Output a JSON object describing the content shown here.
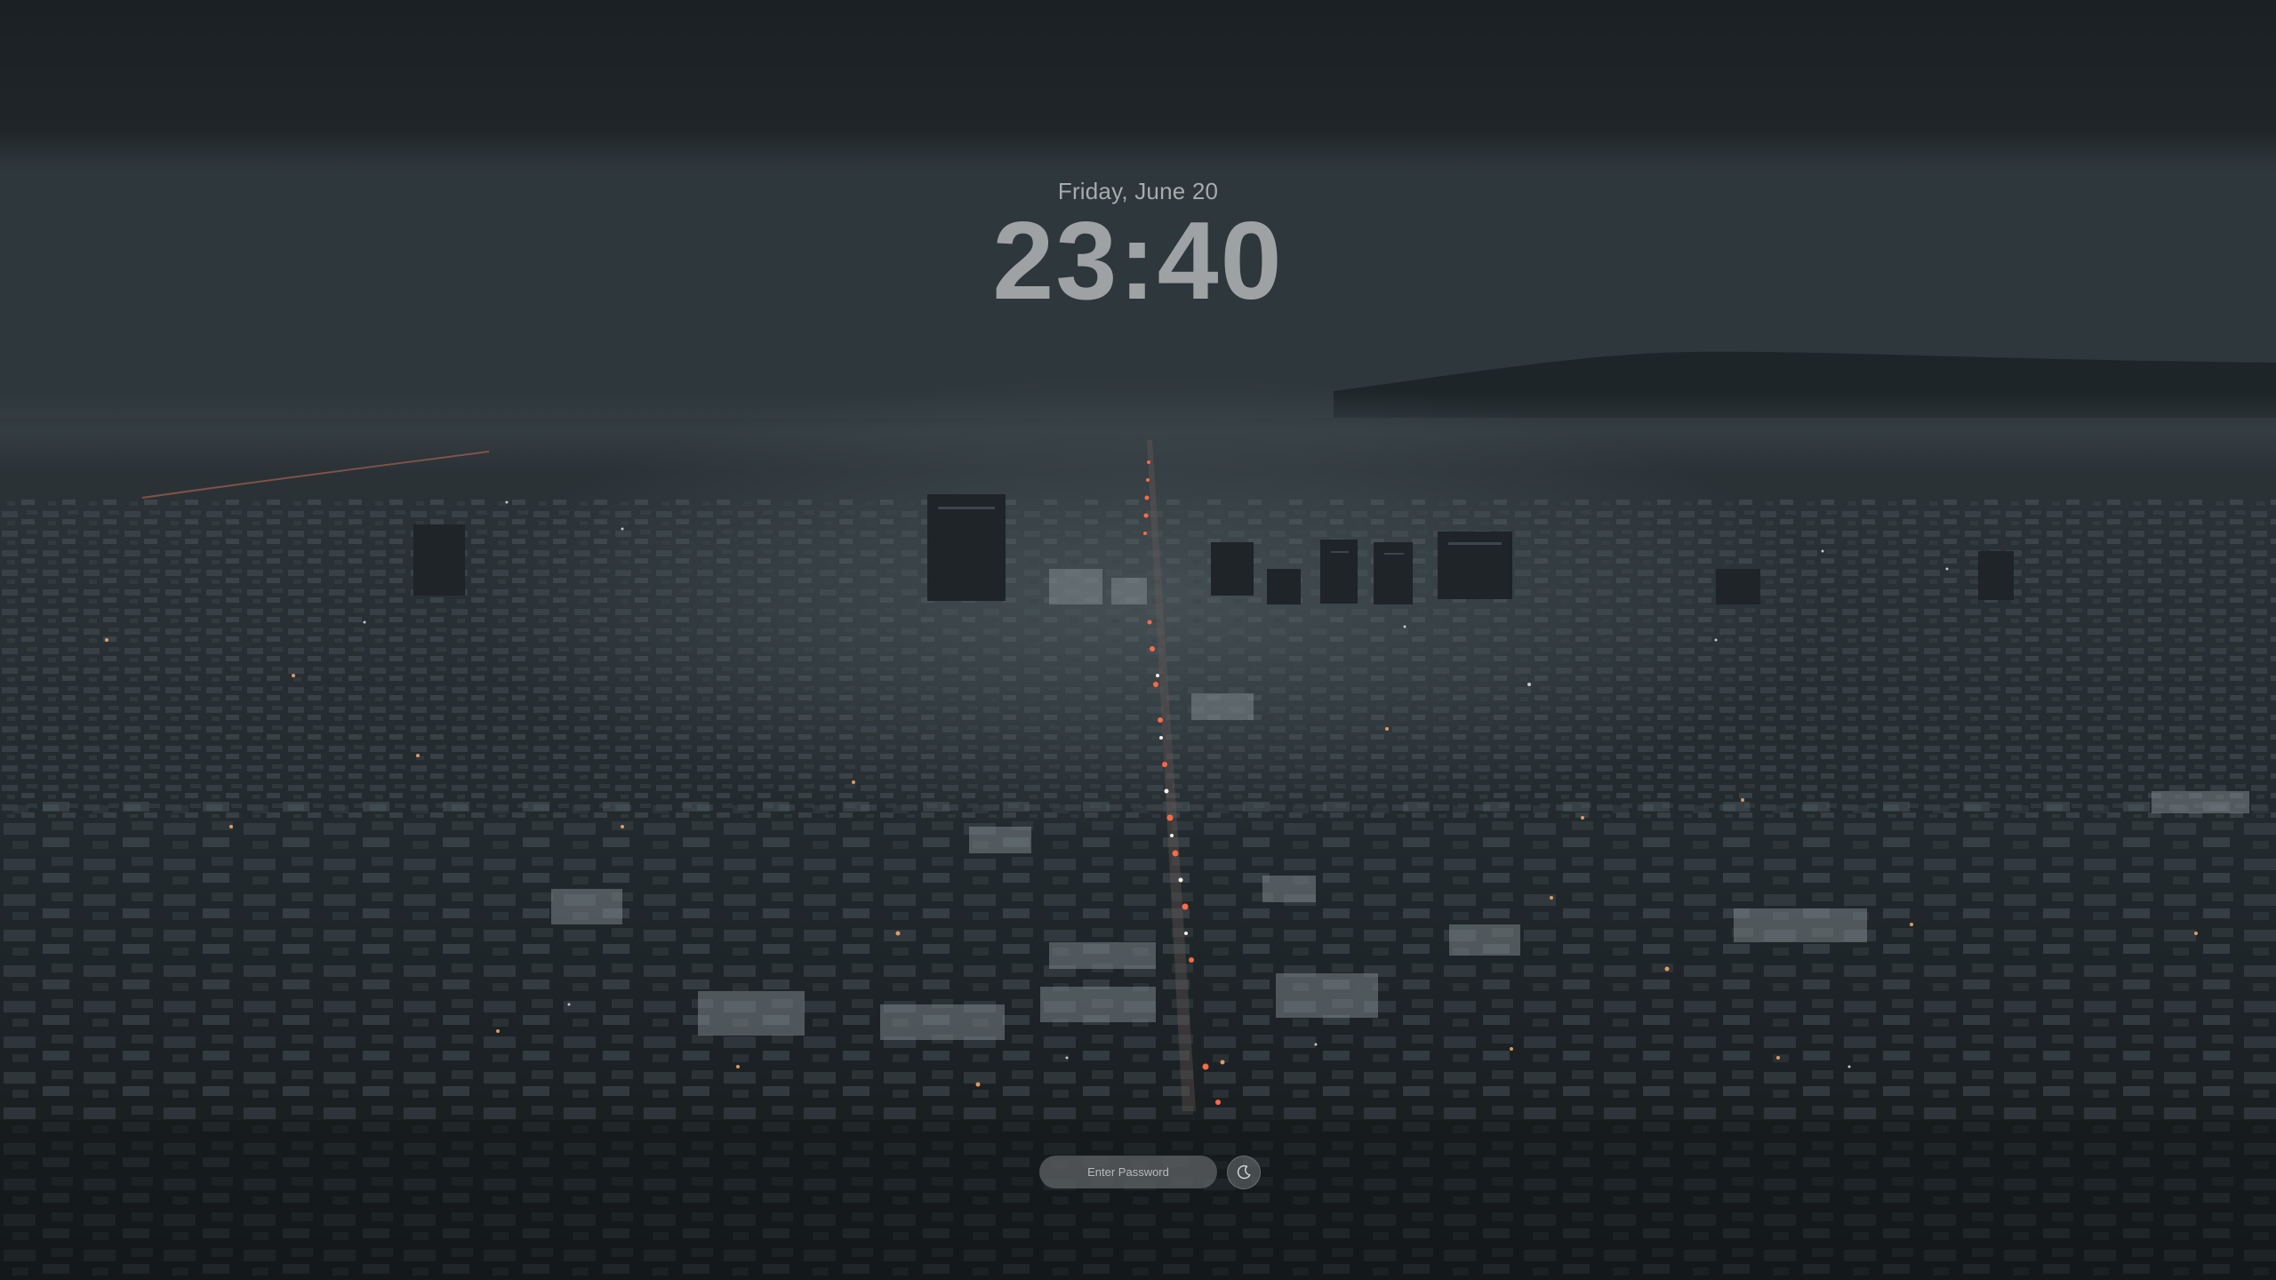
{
  "lock_screen": {
    "date": "Friday, June 20",
    "time": "23:40",
    "password_placeholder": "Enter Password",
    "password_value": ""
  },
  "icons": {
    "sleep_button": "moon-icon"
  },
  "colors": {
    "background": "#1c2226",
    "clock_text": "#9fa2a4",
    "date_text": "#a6abad",
    "password_field": "#5c6062"
  }
}
